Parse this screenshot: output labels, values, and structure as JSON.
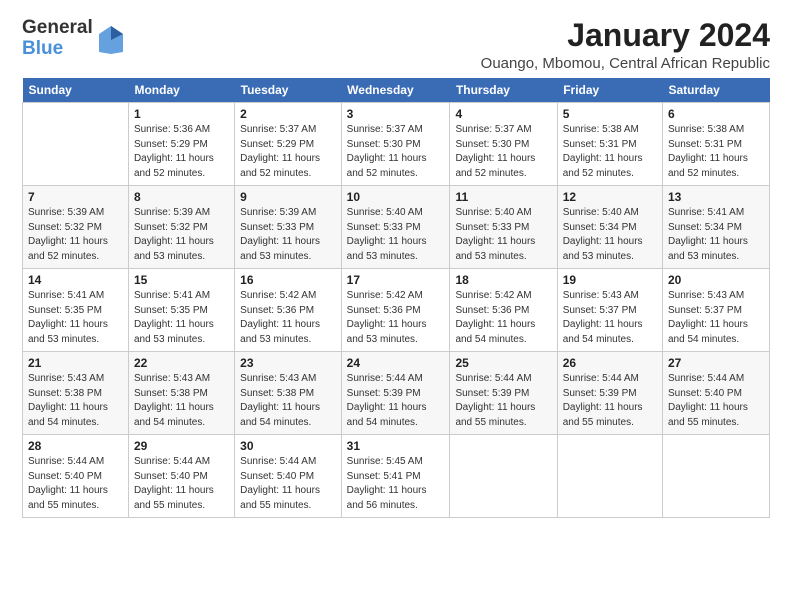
{
  "header": {
    "logo_general": "General",
    "logo_blue": "Blue",
    "month_title": "January 2024",
    "location": "Ouango, Mbomou, Central African Republic"
  },
  "days_of_week": [
    "Sunday",
    "Monday",
    "Tuesday",
    "Wednesday",
    "Thursday",
    "Friday",
    "Saturday"
  ],
  "weeks": [
    [
      {
        "num": "",
        "detail": ""
      },
      {
        "num": "1",
        "detail": "Sunrise: 5:36 AM\nSunset: 5:29 PM\nDaylight: 11 hours\nand 52 minutes."
      },
      {
        "num": "2",
        "detail": "Sunrise: 5:37 AM\nSunset: 5:29 PM\nDaylight: 11 hours\nand 52 minutes."
      },
      {
        "num": "3",
        "detail": "Sunrise: 5:37 AM\nSunset: 5:30 PM\nDaylight: 11 hours\nand 52 minutes."
      },
      {
        "num": "4",
        "detail": "Sunrise: 5:37 AM\nSunset: 5:30 PM\nDaylight: 11 hours\nand 52 minutes."
      },
      {
        "num": "5",
        "detail": "Sunrise: 5:38 AM\nSunset: 5:31 PM\nDaylight: 11 hours\nand 52 minutes."
      },
      {
        "num": "6",
        "detail": "Sunrise: 5:38 AM\nSunset: 5:31 PM\nDaylight: 11 hours\nand 52 minutes."
      }
    ],
    [
      {
        "num": "7",
        "detail": "Sunrise: 5:39 AM\nSunset: 5:32 PM\nDaylight: 11 hours\nand 52 minutes."
      },
      {
        "num": "8",
        "detail": "Sunrise: 5:39 AM\nSunset: 5:32 PM\nDaylight: 11 hours\nand 53 minutes."
      },
      {
        "num": "9",
        "detail": "Sunrise: 5:39 AM\nSunset: 5:33 PM\nDaylight: 11 hours\nand 53 minutes."
      },
      {
        "num": "10",
        "detail": "Sunrise: 5:40 AM\nSunset: 5:33 PM\nDaylight: 11 hours\nand 53 minutes."
      },
      {
        "num": "11",
        "detail": "Sunrise: 5:40 AM\nSunset: 5:33 PM\nDaylight: 11 hours\nand 53 minutes."
      },
      {
        "num": "12",
        "detail": "Sunrise: 5:40 AM\nSunset: 5:34 PM\nDaylight: 11 hours\nand 53 minutes."
      },
      {
        "num": "13",
        "detail": "Sunrise: 5:41 AM\nSunset: 5:34 PM\nDaylight: 11 hours\nand 53 minutes."
      }
    ],
    [
      {
        "num": "14",
        "detail": "Sunrise: 5:41 AM\nSunset: 5:35 PM\nDaylight: 11 hours\nand 53 minutes."
      },
      {
        "num": "15",
        "detail": "Sunrise: 5:41 AM\nSunset: 5:35 PM\nDaylight: 11 hours\nand 53 minutes."
      },
      {
        "num": "16",
        "detail": "Sunrise: 5:42 AM\nSunset: 5:36 PM\nDaylight: 11 hours\nand 53 minutes."
      },
      {
        "num": "17",
        "detail": "Sunrise: 5:42 AM\nSunset: 5:36 PM\nDaylight: 11 hours\nand 53 minutes."
      },
      {
        "num": "18",
        "detail": "Sunrise: 5:42 AM\nSunset: 5:36 PM\nDaylight: 11 hours\nand 54 minutes."
      },
      {
        "num": "19",
        "detail": "Sunrise: 5:43 AM\nSunset: 5:37 PM\nDaylight: 11 hours\nand 54 minutes."
      },
      {
        "num": "20",
        "detail": "Sunrise: 5:43 AM\nSunset: 5:37 PM\nDaylight: 11 hours\nand 54 minutes."
      }
    ],
    [
      {
        "num": "21",
        "detail": "Sunrise: 5:43 AM\nSunset: 5:38 PM\nDaylight: 11 hours\nand 54 minutes."
      },
      {
        "num": "22",
        "detail": "Sunrise: 5:43 AM\nSunset: 5:38 PM\nDaylight: 11 hours\nand 54 minutes."
      },
      {
        "num": "23",
        "detail": "Sunrise: 5:43 AM\nSunset: 5:38 PM\nDaylight: 11 hours\nand 54 minutes."
      },
      {
        "num": "24",
        "detail": "Sunrise: 5:44 AM\nSunset: 5:39 PM\nDaylight: 11 hours\nand 54 minutes."
      },
      {
        "num": "25",
        "detail": "Sunrise: 5:44 AM\nSunset: 5:39 PM\nDaylight: 11 hours\nand 55 minutes."
      },
      {
        "num": "26",
        "detail": "Sunrise: 5:44 AM\nSunset: 5:39 PM\nDaylight: 11 hours\nand 55 minutes."
      },
      {
        "num": "27",
        "detail": "Sunrise: 5:44 AM\nSunset: 5:40 PM\nDaylight: 11 hours\nand 55 minutes."
      }
    ],
    [
      {
        "num": "28",
        "detail": "Sunrise: 5:44 AM\nSunset: 5:40 PM\nDaylight: 11 hours\nand 55 minutes."
      },
      {
        "num": "29",
        "detail": "Sunrise: 5:44 AM\nSunset: 5:40 PM\nDaylight: 11 hours\nand 55 minutes."
      },
      {
        "num": "30",
        "detail": "Sunrise: 5:44 AM\nSunset: 5:40 PM\nDaylight: 11 hours\nand 55 minutes."
      },
      {
        "num": "31",
        "detail": "Sunrise: 5:45 AM\nSunset: 5:41 PM\nDaylight: 11 hours\nand 56 minutes."
      },
      {
        "num": "",
        "detail": ""
      },
      {
        "num": "",
        "detail": ""
      },
      {
        "num": "",
        "detail": ""
      }
    ]
  ]
}
